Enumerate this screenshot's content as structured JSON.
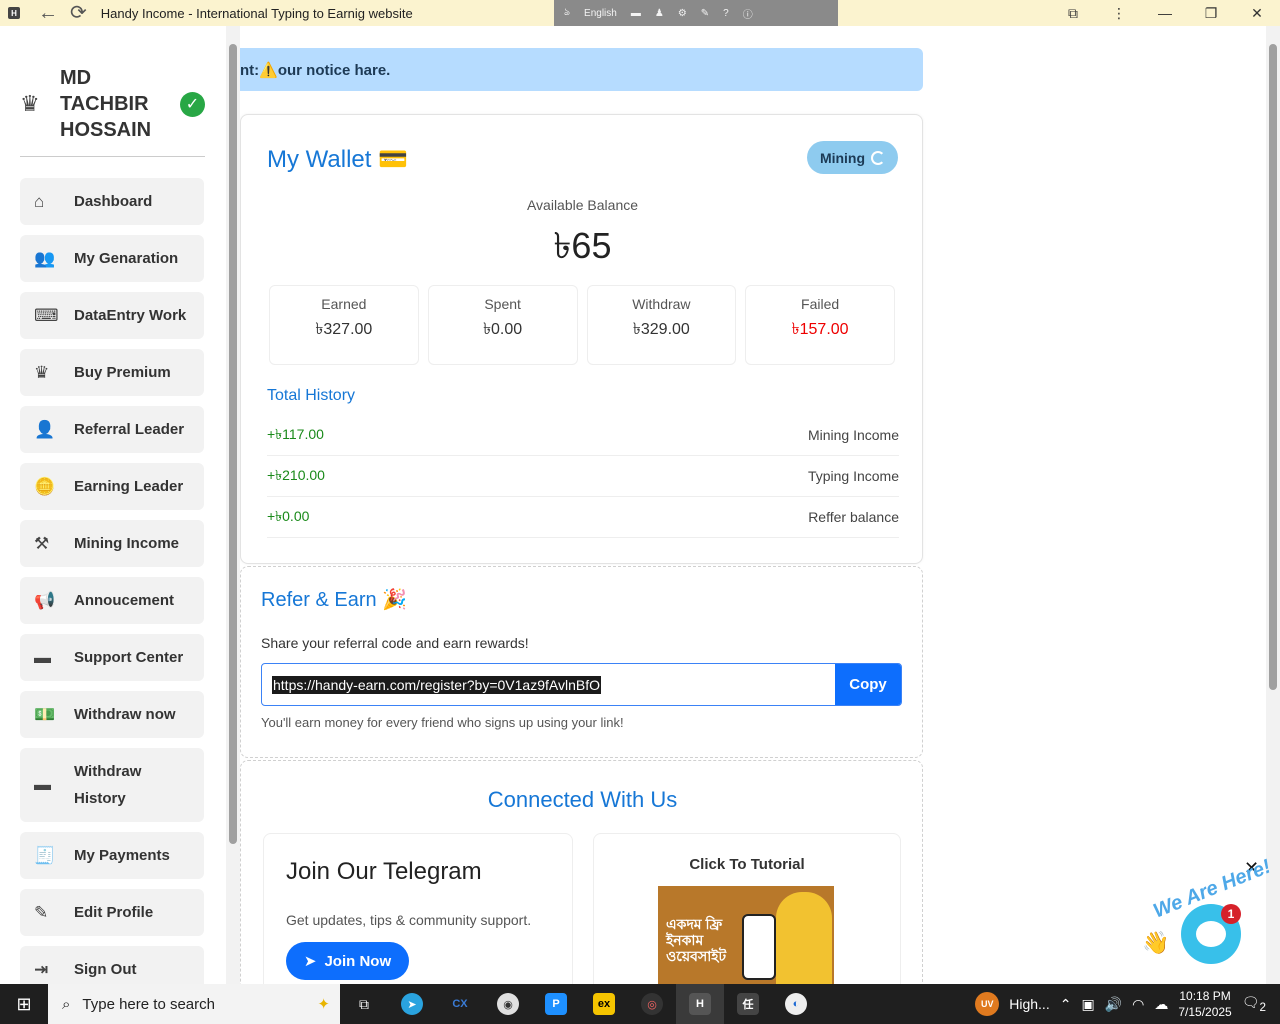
{
  "browser": {
    "title": "Handy Income - International Typing to Earnig website",
    "favicon": "H"
  },
  "ime": {
    "language": "English"
  },
  "user": {
    "name": "MD TACHBIR HOSSAIN"
  },
  "menu": [
    {
      "icon": "home-icon",
      "glyph": "⌂",
      "label": "Dashboard"
    },
    {
      "icon": "users-icon",
      "glyph": "👥",
      "label": "My Genaration"
    },
    {
      "icon": "keyboard-icon",
      "glyph": "⌨",
      "label": "DataEntry Work"
    },
    {
      "icon": "crown-icon",
      "glyph": "♛",
      "label": "Buy Premium"
    },
    {
      "icon": "user-group-icon",
      "glyph": "👤",
      "label": "Referral Leader"
    },
    {
      "icon": "coins-icon",
      "glyph": "🪙",
      "label": "Earning Leader"
    },
    {
      "icon": "hammer-icon",
      "glyph": "⚒",
      "label": "Mining Income"
    },
    {
      "icon": "bullhorn-icon",
      "glyph": "📢",
      "label": "Annoucement"
    },
    {
      "icon": "wallet-icon",
      "glyph": "▬",
      "label": "Support Center"
    },
    {
      "icon": "money-icon",
      "glyph": "💵",
      "label": "Withdraw now"
    },
    {
      "icon": "wallet-history-icon",
      "glyph": "▬",
      "label": "Withdraw History"
    },
    {
      "icon": "receipt-icon",
      "glyph": "🧾",
      "label": "My Payments"
    },
    {
      "icon": "user-edit-icon",
      "glyph": "✎",
      "label": "Edit Profile"
    },
    {
      "icon": "signout-icon",
      "glyph": "⇥",
      "label": "Sign Out"
    }
  ],
  "notice": {
    "text": "nt:⚠️our notice hare."
  },
  "wallet": {
    "title": "My Wallet",
    "mining_label": "Mining",
    "available_label": "Available Balance",
    "balance": "৳65",
    "stats": [
      {
        "label": "Earned",
        "value": "৳327.00"
      },
      {
        "label": "Spent",
        "value": "৳0.00"
      },
      {
        "label": "Withdraw",
        "value": "৳329.00"
      },
      {
        "label": "Failed",
        "value": "৳157.00"
      }
    ],
    "history_title": "Total History",
    "history": [
      {
        "amount": "+৳117.00",
        "label": "Mining Income"
      },
      {
        "amount": "+৳210.00",
        "label": "Typing Income"
      },
      {
        "amount": "+৳0.00",
        "label": "Reffer balance"
      }
    ]
  },
  "refer": {
    "title": "Refer & Earn",
    "subtitle": "Share your referral code and earn rewards!",
    "link": "https://handy-earn.com/register?by=0V1az9fAvlnBfO",
    "copy_label": "Copy",
    "note": "You'll earn money for every friend who signs up using your link!"
  },
  "connect": {
    "title": "Connected With Us",
    "telegram": {
      "title": "Join Our Telegram",
      "desc": "Get updates, tips & community support.",
      "button": "Join Now"
    },
    "tutorial": {
      "title": "Click To Tutorial",
      "banner_text": "একদম ফ্রি ইনকাম ওয়েবসাইট"
    }
  },
  "chat_widget": {
    "text": "We Are Here!",
    "badge": "1"
  },
  "taskbar": {
    "search_placeholder": "Type here to search",
    "tray_label": "High...",
    "time": "10:18 PM",
    "date": "7/15/2025",
    "notif_count": "2"
  }
}
